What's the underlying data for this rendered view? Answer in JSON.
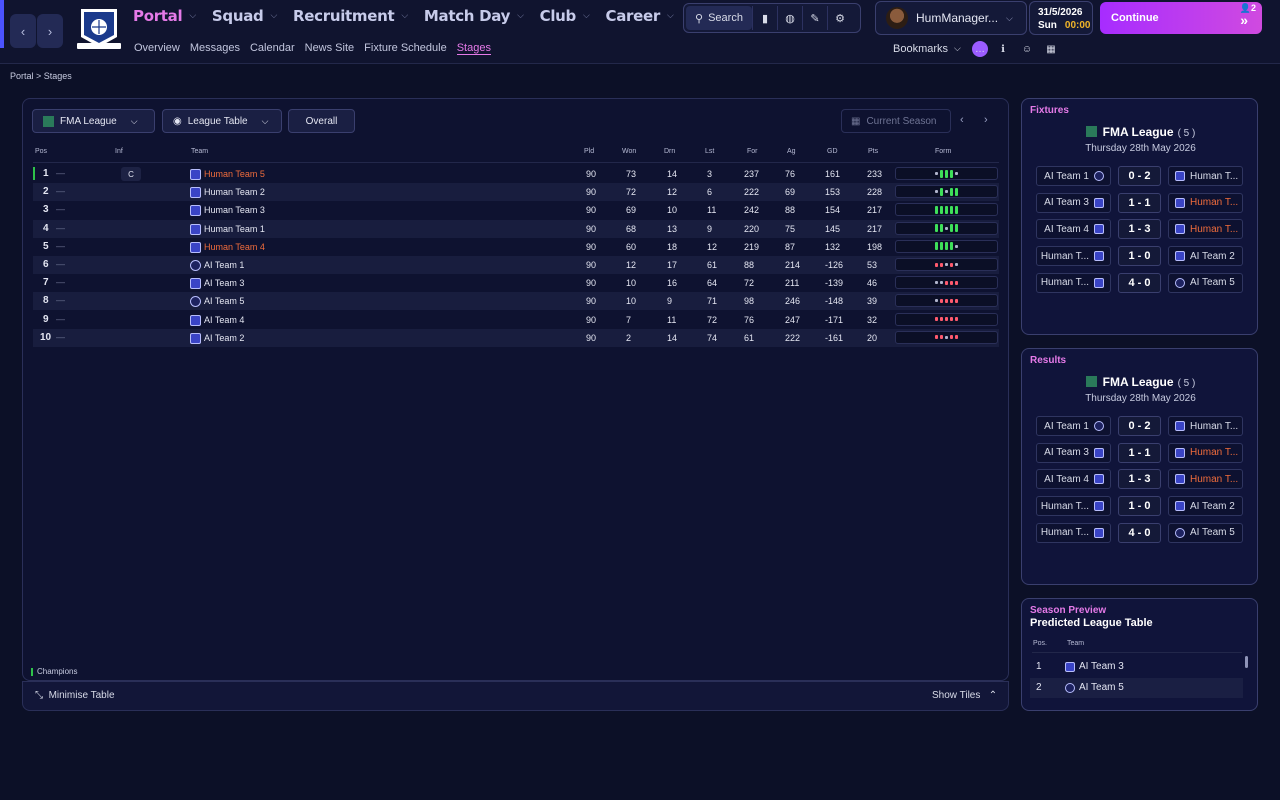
{
  "header": {
    "main_nav": [
      "Portal",
      "Squad",
      "Recruitment",
      "Match Day",
      "Club",
      "Career"
    ],
    "sub_nav": [
      "Overview",
      "Messages",
      "Calendar",
      "News Site",
      "Fixture Schedule",
      "Stages"
    ],
    "search_label": "Search",
    "manager_name": "HumManager...",
    "date": "31/5/2026",
    "day": "Sun",
    "time": "00:00",
    "continue_label": "Continue",
    "notifications": "2",
    "bookmarks_label": "Bookmarks",
    "accent_color": "#e57ae8"
  },
  "breadcrumb": {
    "root": "Portal",
    "current": "Stages"
  },
  "table_controls": {
    "competition": "FMA League",
    "view": "League Table",
    "filter": "Overall",
    "season": "Current Season"
  },
  "columns": [
    "Pos",
    "Inf",
    "Team",
    "Pld",
    "Won",
    "Drn",
    "Lst",
    "For",
    "Ag",
    "GD",
    "Pts",
    "Form"
  ],
  "rows": [
    {
      "pos": "1",
      "inf": "C",
      "team": "Human Team 5",
      "pld": "90",
      "won": "73",
      "drn": "14",
      "lst": "3",
      "for": "237",
      "ag": "76",
      "gd": "161",
      "pts": "233",
      "form": [
        "d",
        "w",
        "w",
        "w",
        "d"
      ],
      "highlight": true
    },
    {
      "pos": "2",
      "inf": "",
      "team": "Human Team 2",
      "pld": "90",
      "won": "72",
      "drn": "12",
      "lst": "6",
      "for": "222",
      "ag": "69",
      "gd": "153",
      "pts": "228",
      "form": [
        "d",
        "w",
        "d",
        "w",
        "w"
      ],
      "highlight": false
    },
    {
      "pos": "3",
      "inf": "",
      "team": "Human Team 3",
      "pld": "90",
      "won": "69",
      "drn": "10",
      "lst": "11",
      "for": "242",
      "ag": "88",
      "gd": "154",
      "pts": "217",
      "form": [
        "w",
        "w",
        "w",
        "w",
        "w"
      ],
      "highlight": false
    },
    {
      "pos": "4",
      "inf": "",
      "team": "Human Team 1",
      "pld": "90",
      "won": "68",
      "drn": "13",
      "lst": "9",
      "for": "220",
      "ag": "75",
      "gd": "145",
      "pts": "217",
      "form": [
        "w",
        "w",
        "d",
        "w",
        "w"
      ],
      "highlight": false
    },
    {
      "pos": "5",
      "inf": "",
      "team": "Human Team 4",
      "pld": "90",
      "won": "60",
      "drn": "18",
      "lst": "12",
      "for": "219",
      "ag": "87",
      "gd": "132",
      "pts": "198",
      "form": [
        "w",
        "w",
        "w",
        "w",
        "d"
      ],
      "highlight": true
    },
    {
      "pos": "6",
      "inf": "",
      "team": "AI Team 1",
      "pld": "90",
      "won": "12",
      "drn": "17",
      "lst": "61",
      "for": "88",
      "ag": "214",
      "gd": "-126",
      "pts": "53",
      "form": [
        "l",
        "l",
        "d",
        "l",
        "d"
      ],
      "highlight": false
    },
    {
      "pos": "7",
      "inf": "",
      "team": "AI Team 3",
      "pld": "90",
      "won": "10",
      "drn": "16",
      "lst": "64",
      "for": "72",
      "ag": "211",
      "gd": "-139",
      "pts": "46",
      "form": [
        "d",
        "d",
        "l",
        "l",
        "l"
      ],
      "highlight": false
    },
    {
      "pos": "8",
      "inf": "",
      "team": "AI Team 5",
      "pld": "90",
      "won": "10",
      "drn": "9",
      "lst": "71",
      "for": "98",
      "ag": "246",
      "gd": "-148",
      "pts": "39",
      "form": [
        "d",
        "l",
        "l",
        "l",
        "l"
      ],
      "highlight": false
    },
    {
      "pos": "9",
      "inf": "",
      "team": "AI Team 4",
      "pld": "90",
      "won": "7",
      "drn": "11",
      "lst": "72",
      "for": "76",
      "ag": "247",
      "gd": "-171",
      "pts": "32",
      "form": [
        "l",
        "l",
        "l",
        "l",
        "l"
      ],
      "highlight": false
    },
    {
      "pos": "10",
      "inf": "",
      "team": "AI Team 2",
      "pld": "90",
      "won": "2",
      "drn": "14",
      "lst": "74",
      "for": "61",
      "ag": "222",
      "gd": "-161",
      "pts": "20",
      "form": [
        "l",
        "l",
        "d",
        "l",
        "l"
      ],
      "highlight": false
    }
  ],
  "legend": {
    "champions": "Champions"
  },
  "bottom": {
    "minimise": "Minimise Table",
    "show_tiles": "Show Tiles"
  },
  "fixtures": {
    "title": "Fixtures",
    "league": "FMA League",
    "count": "( 5 )",
    "date": "Thursday 28th May 2026",
    "matches": [
      {
        "home": "AI Team 1",
        "score": "0 - 2",
        "away": "Human T...",
        "away_hl": false
      },
      {
        "home": "AI Team 3",
        "score": "1 - 1",
        "away": "Human T...",
        "away_hl": true
      },
      {
        "home": "AI Team 4",
        "score": "1 - 3",
        "away": "Human T...",
        "away_hl": true
      },
      {
        "home": "Human T...",
        "score": "1 - 0",
        "away": "AI Team 2",
        "away_hl": false
      },
      {
        "home": "Human T...",
        "score": "4 - 0",
        "away": "AI Team 5",
        "away_hl": false
      }
    ]
  },
  "results": {
    "title": "Results",
    "league": "FMA League",
    "count": "( 5 )",
    "date": "Thursday 28th May 2026",
    "matches": [
      {
        "home": "AI Team 1",
        "score": "0 - 2",
        "away": "Human T...",
        "away_hl": false
      },
      {
        "home": "AI Team 3",
        "score": "1 - 1",
        "away": "Human T...",
        "away_hl": true
      },
      {
        "home": "AI Team 4",
        "score": "1 - 3",
        "away": "Human T...",
        "away_hl": true
      },
      {
        "home": "Human T...",
        "score": "1 - 0",
        "away": "AI Team 2",
        "away_hl": false
      },
      {
        "home": "Human T...",
        "score": "4 - 0",
        "away": "AI Team 5",
        "away_hl": false
      }
    ]
  },
  "preview": {
    "title": "Season Preview",
    "subtitle": "Predicted League Table",
    "col_pos": "Pos.",
    "col_team": "Team",
    "rows": [
      {
        "pos": "1",
        "team": "AI Team 3"
      },
      {
        "pos": "2",
        "team": "AI Team 5"
      }
    ]
  }
}
